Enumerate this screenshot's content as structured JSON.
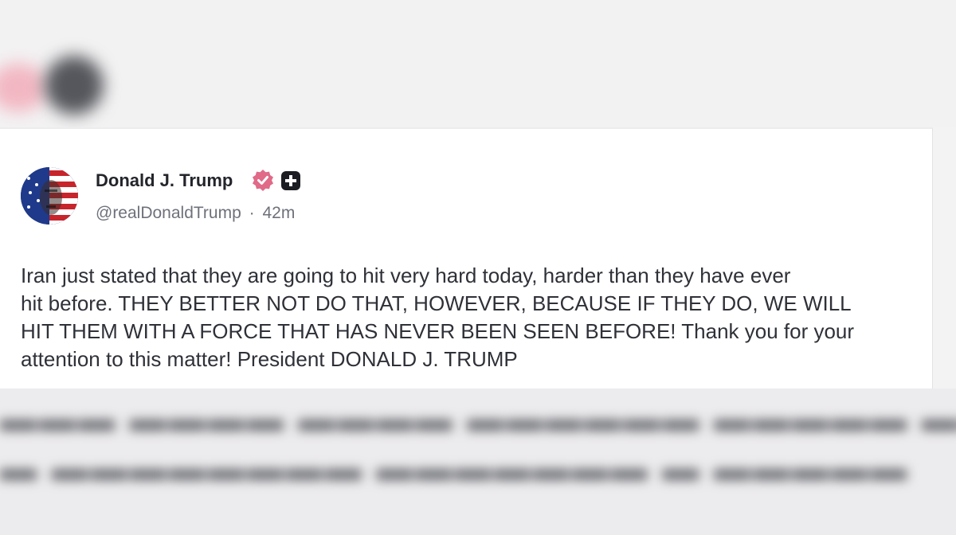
{
  "post": {
    "author_name": "Donald J. Trump",
    "handle": "@realDonaldTrump",
    "separator": "·",
    "time_ago": "42m",
    "text": "Iran just stated that they are going to hit very hard today, harder than they have ever\nhit before. THEY BETTER NOT DO THAT, HOWEVER, BECAUSE IF THEY DO, WE WILL\nHIT THEM WITH A FORCE THAT HAS NEVER BEEN SEEN BEFORE! Thank you for your\nattention to this matter! President DONALD J. TRUMP"
  },
  "icons": {
    "verified": "verified-badge-icon",
    "plus": "plus-badge-icon",
    "avatar": "avatar"
  },
  "colors": {
    "verified_badge": "#e06a88",
    "plus_badge": "#1c1d22",
    "name_text": "#23252b",
    "handle_text": "#6e717a"
  }
}
